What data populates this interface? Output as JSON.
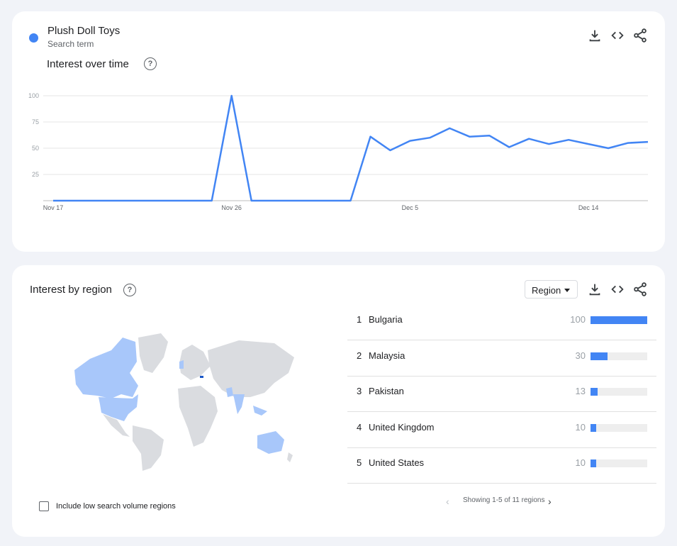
{
  "term": {
    "name": "Plush Doll Toys",
    "sub": "Search term",
    "color": "#4285f4"
  },
  "interest_over_time": {
    "title": "Interest over time",
    "help": "?"
  },
  "chart_data": {
    "type": "line",
    "x_ticks": [
      "Nov 17",
      "Nov 26",
      "Dec 5",
      "Dec 14"
    ],
    "y_ticks": [
      25,
      50,
      75,
      100
    ],
    "ylim": [
      0,
      100
    ],
    "grid": true,
    "series": [
      {
        "values": [
          0,
          0,
          0,
          0,
          0,
          0,
          0,
          0,
          0,
          100,
          0,
          0,
          0,
          0,
          0,
          0,
          61,
          48,
          57,
          60,
          69,
          61,
          62,
          51,
          59,
          54,
          58,
          54,
          50,
          55,
          56
        ]
      }
    ]
  },
  "interest_by_region": {
    "title": "Interest by region",
    "help": "?",
    "dropdown": "Region",
    "rows": [
      {
        "rank": "1",
        "name": "Bulgaria",
        "value": "100",
        "pct": 100
      },
      {
        "rank": "2",
        "name": "Malaysia",
        "value": "30",
        "pct": 30
      },
      {
        "rank": "3",
        "name": "Pakistan",
        "value": "13",
        "pct": 13
      },
      {
        "rank": "4",
        "name": "United Kingdom",
        "value": "10",
        "pct": 10
      },
      {
        "rank": "5",
        "name": "United States",
        "value": "10",
        "pct": 10
      }
    ],
    "pager": "Showing 1-5 of 11 regions",
    "checkbox_label": "Include low search volume regions",
    "map_colors": {
      "land": "#dadce0",
      "low": "#a8c7fa",
      "high": "#1a57c8"
    }
  }
}
